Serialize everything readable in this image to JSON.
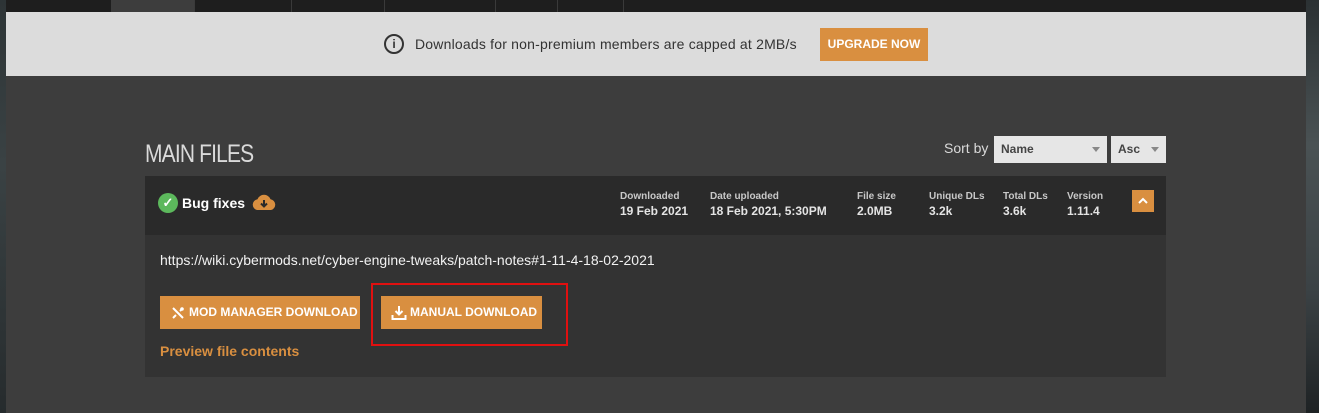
{
  "banner": {
    "info_icon": "info-icon",
    "text": "Downloads for non-premium members are capped at 2MB/s",
    "upgrade_label": "UPGRADE NOW",
    "accent_color": "#d98f40"
  },
  "section": {
    "title": "MAIN FILES",
    "sort_label": "Sort by",
    "sort_field": "Name",
    "sort_order": "Asc"
  },
  "file": {
    "name": "Bug fixes",
    "status_icon": "check-circle-icon",
    "download_icon": "cloud-download-icon",
    "stats": [
      {
        "label": "Downloaded",
        "value": "19 Feb 2021"
      },
      {
        "label": "Date uploaded",
        "value": "18 Feb 2021, 5:30PM"
      },
      {
        "label": "File size",
        "value": "2.0MB"
      },
      {
        "label": "Unique DLs",
        "value": "3.2k"
      },
      {
        "label": "Total DLs",
        "value": "3.6k"
      },
      {
        "label": "Version",
        "value": "1.11.4"
      }
    ],
    "description_link": "https://wiki.cybermods.net/cyber-engine-tweaks/patch-notes#1-11-4-18-02-2021",
    "mod_manager_label": "MOD MANAGER DOWNLOAD",
    "manual_label": "MANUAL DOWNLOAD",
    "preview_label": "Preview file contents"
  }
}
